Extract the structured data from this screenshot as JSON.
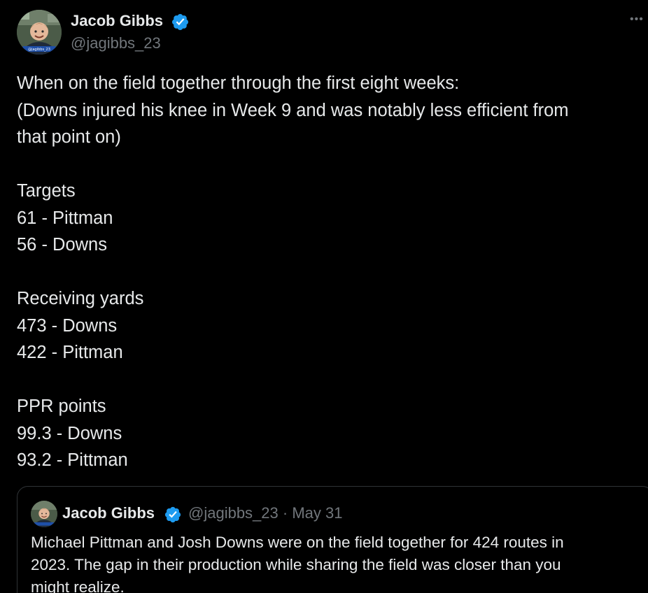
{
  "author": {
    "name": "Jacob Gibbs",
    "handle": "@jagibbs_23",
    "avatar_caption": "@jagibbs_23"
  },
  "more_label": "•••",
  "colors": {
    "background": "#000000",
    "text": "#e7e9ea",
    "muted": "#71767b",
    "verified": "#1d9bf0",
    "border": "#2f3336"
  },
  "tweet": {
    "lines": [
      "When on the field together through the first eight weeks:",
      "(Downs injured his knee in Week 9 and was notably less efficient from",
      "that point on)",
      "",
      "Targets",
      "61 - Pittman",
      "56 - Downs",
      "",
      "Receiving yards",
      "473 - Downs",
      "422 - Pittman",
      "",
      "PPR points",
      "99.3 - Downs",
      "93.2 - Pittman"
    ]
  },
  "quote": {
    "name": "Jacob Gibbs",
    "handle": "@jagibbs_23",
    "separator": "·",
    "date": "May 31",
    "lines": [
      "Michael Pittman and Josh Downs were on the field together for 424 routes in",
      "2023. The gap in their production while sharing the field was closer than you",
      "might realize."
    ]
  }
}
